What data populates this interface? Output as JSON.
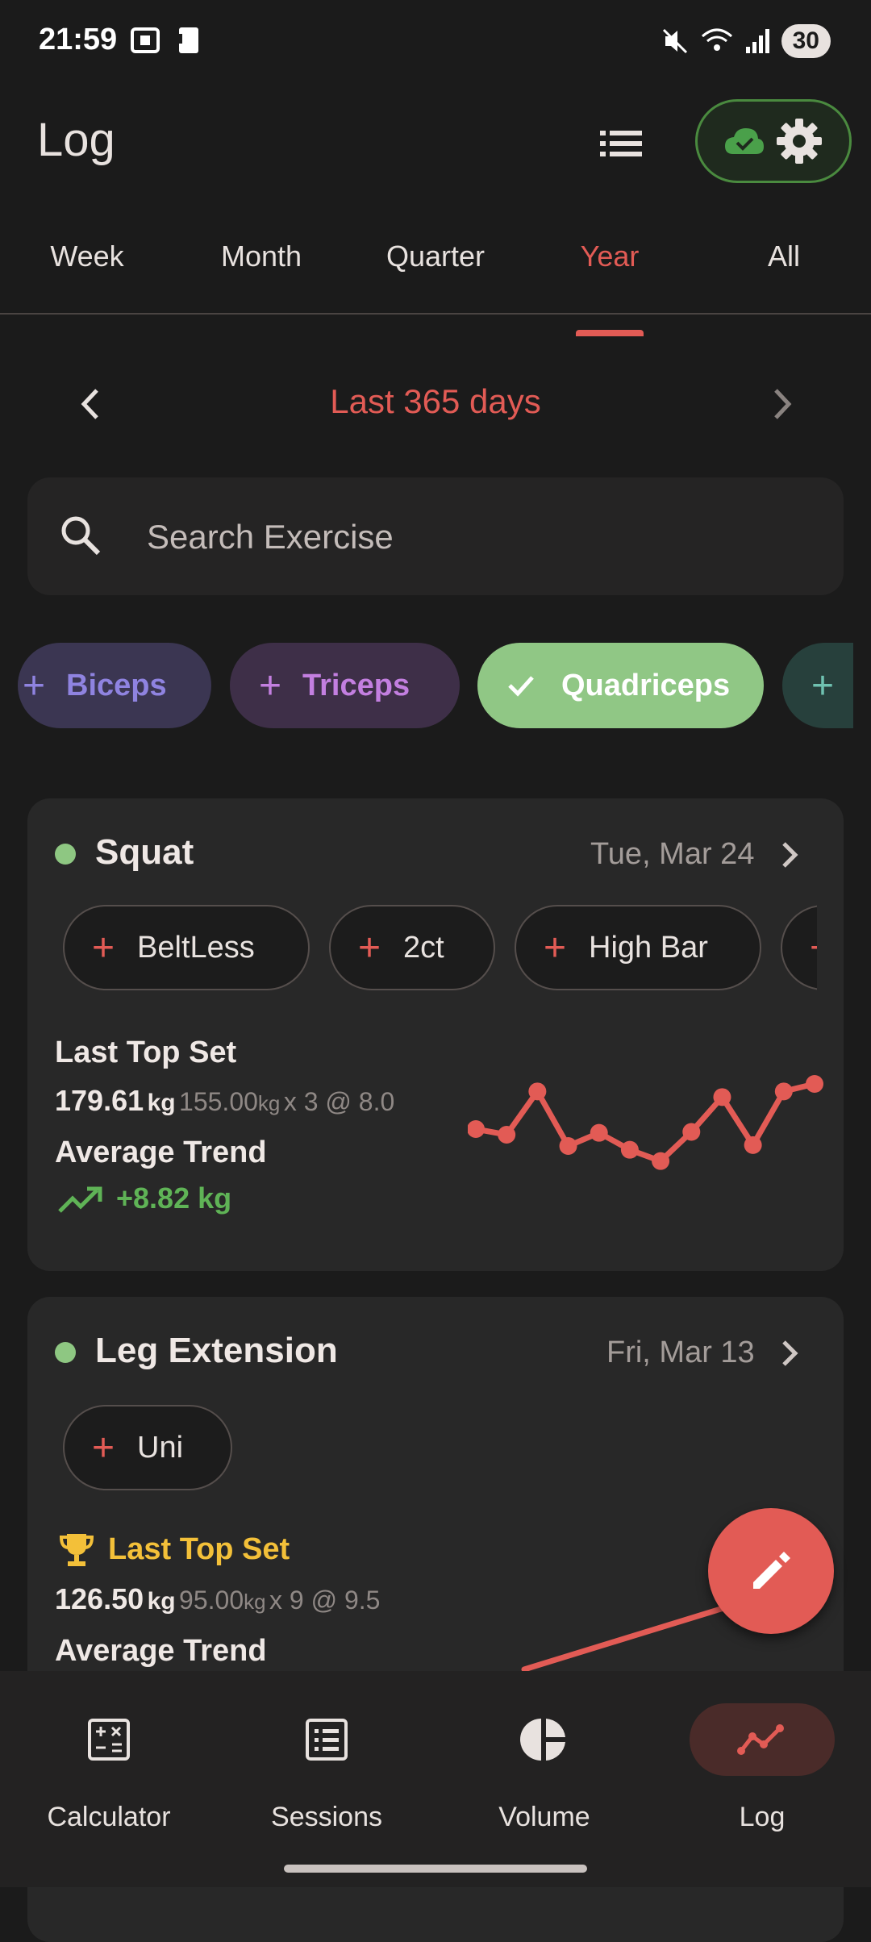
{
  "status_bar": {
    "time": "21:59",
    "battery": "30"
  },
  "header": {
    "title": "Log"
  },
  "tabs": [
    "Week",
    "Month",
    "Quarter",
    "Year",
    "All"
  ],
  "active_tab": "Year",
  "range": {
    "label": "Last 365 days"
  },
  "search": {
    "placeholder": "Search Exercise"
  },
  "filter_chips": [
    {
      "label": "Biceps",
      "selected": false,
      "color": "#8f83e0",
      "bg": "#3b3652"
    },
    {
      "label": "Triceps",
      "selected": false,
      "color": "#c37fe0",
      "bg": "#3e2f48"
    },
    {
      "label": "Quadriceps",
      "selected": true,
      "color": "#ffffff",
      "bg": "#90c785"
    },
    {
      "label": "",
      "selected": false,
      "color": "#6fc1b0",
      "bg": "#27403c"
    }
  ],
  "cards": [
    {
      "name": "Squat",
      "date": "Tue, Mar 24",
      "tags": [
        "BeltLess",
        "2ct",
        "High Bar"
      ],
      "last_top_set_label": "Last Top Set",
      "top_set_value": "179.61",
      "top_set_unit": "kg",
      "top_set_raw": "155.00",
      "top_set_raw_unit": "kg",
      "top_set_detail": "x 3 @ 8.0",
      "avg_trend_label": "Average Trend",
      "avg_trend_value": "+8.82 kg",
      "sparkline": [
        60,
        54,
        100,
        42,
        56,
        38,
        26,
        57,
        94,
        43,
        100,
        108
      ]
    },
    {
      "name": "Leg Extension",
      "date": "Fri, Mar 13",
      "tags": [
        "Uni"
      ],
      "last_top_set_label": "Last Top Set",
      "top_set_value": "126.50",
      "top_set_unit": "kg",
      "top_set_raw": "95.00",
      "top_set_raw_unit": "kg",
      "top_set_detail": "x 9 @ 9.5",
      "avg_trend_label": "Average Trend"
    }
  ],
  "bottom_nav": [
    {
      "label": "Calculator",
      "icon": "calculator-icon"
    },
    {
      "label": "Sessions",
      "icon": "list-alt-icon"
    },
    {
      "label": "Volume",
      "icon": "pie-chart-icon"
    },
    {
      "label": "Log",
      "icon": "trend-line-icon",
      "active": true
    }
  ],
  "colors": {
    "accent": "#e25b55",
    "success": "#5fb356",
    "gold": "#f3c039"
  }
}
